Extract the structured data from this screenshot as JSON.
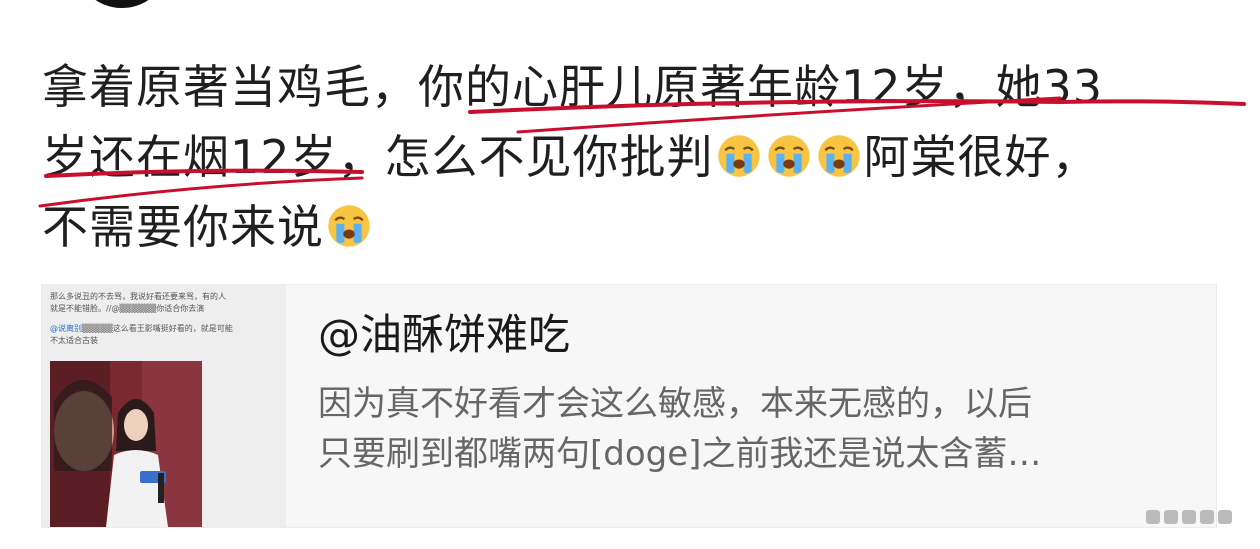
{
  "post": {
    "line1": "拿着原著当鸡毛，你的心肝儿原著年龄12岁，她33",
    "line2_a": "岁还在烟12岁，怎么不见你批判",
    "line2_b": "阿棠很好，",
    "line3_a": "不需要你来说",
    "emoji_icon": "loudly-crying-face-icon"
  },
  "card": {
    "title": "@油酥饼难吃",
    "desc_line1": "因为真不好看才会这么敏感，本来无感的，以后",
    "desc_line2": "只要刷到都嘴两句[doge]之前我还是说太含蓄…",
    "thumb": {
      "line1": "那么多说丑的不去骂，我说好看还要来骂，有的人",
      "line2": "就是不能错脸。//@",
      "line2_tail": "你适合你去演",
      "mention": "@说离别",
      "line3_tail": "这么看王影嘴挺好看的，就是可能",
      "line4": "不太适合古装"
    }
  },
  "colors": {
    "annotation_red": "#c8102e",
    "text": "#1f1f1f",
    "card_bg": "#f7f7f7",
    "desc_gray": "#666666"
  }
}
